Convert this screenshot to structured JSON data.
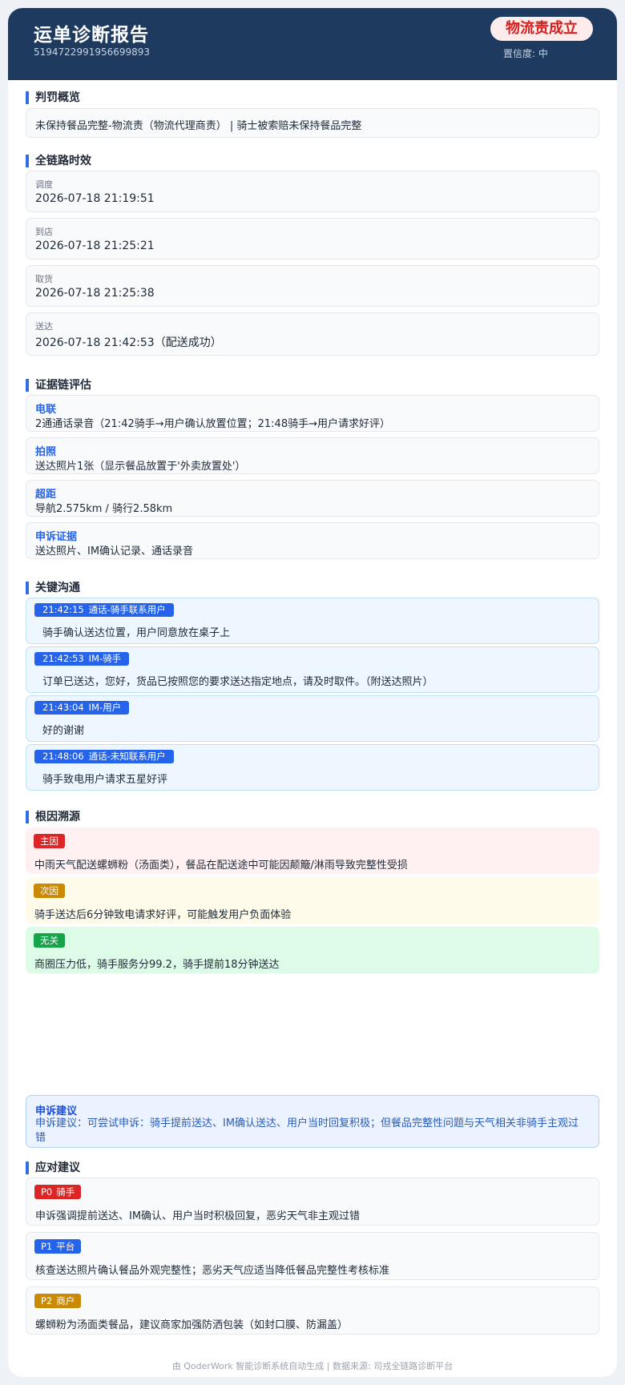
{
  "colors": {
    "header_bg": "#1e3a5f",
    "accent": "#2f6ee5",
    "verdict_red": "#d61f1f",
    "primary_tag": "#dc2626",
    "secondary_tag": "#ca8a04",
    "unrelated_tag": "#16a34a",
    "p1_tag": "#2563eb"
  },
  "header": {
    "title": "运单诊断报告",
    "order_id": "5194722991956699893",
    "verdict": "物流责成立",
    "confidence": "置信度: 中"
  },
  "penalty": {
    "title": "判罚概览",
    "text": "未保持餐品完整-物流责（物流代理商责） | 骑士被索赔未保持餐品完整"
  },
  "timeline": {
    "title": "全链路时效",
    "items": [
      {
        "label": "调度",
        "value": "2026-07-18 21:19:51"
      },
      {
        "label": "到店",
        "value": "2026-07-18 21:25:21"
      },
      {
        "label": "取货",
        "value": "2026-07-18 21:25:38"
      },
      {
        "label": "送达",
        "value": "2026-07-18 21:42:53（配送成功）"
      }
    ]
  },
  "evidence": {
    "title": "证据链评估",
    "items": [
      {
        "key": "电联",
        "value": "2通通话录音（21:42骑手→用户确认放置位置；21:48骑手→用户请求好评）"
      },
      {
        "key": "拍照",
        "value": "送达照片1张（显示餐品放置于'外卖放置处'）"
      },
      {
        "key": "超距",
        "value": "导航2.575km / 骑行2.58km"
      },
      {
        "key": "申诉证据",
        "value": "送达照片、IM确认记录、通话录音"
      }
    ]
  },
  "communication": {
    "title": "关键沟通",
    "items": [
      {
        "time": "21:42:15",
        "type": "通话-骑手联系用户",
        "text": "骑手确认送达位置，用户同意放在桌子上"
      },
      {
        "time": "21:42:53",
        "type": "IM-骑手",
        "text": "订单已送达，您好，货品已按照您的要求送达指定地点，请及时取件。（附送达照片）"
      },
      {
        "time": "21:43:04",
        "type": "IM-用户",
        "text": "好的谢谢"
      },
      {
        "time": "21:48:06",
        "type": "通话-未知联系用户",
        "text": "骑手致电用户请求五星好评"
      }
    ]
  },
  "root_cause": {
    "title": "根因溯源",
    "items": [
      {
        "tag": "主因",
        "text": "中雨天气配送螺蛳粉（汤面类），餐品在配送途中可能因颠簸/淋雨导致完整性受损"
      },
      {
        "tag": "次因",
        "text": "骑手送达后6分钟致电请求好评，可能触发用户负面体验"
      },
      {
        "tag": "无关",
        "text": "商圈压力低，骑手服务分99.2，骑手提前18分钟送达"
      }
    ]
  },
  "appeal": {
    "title": "申诉建议",
    "text": "申诉建议：可尝试申诉：骑手提前送达、IM确认送达、用户当时回复积极；但餐品完整性问题与天气相关非骑手主观过错"
  },
  "actions": {
    "title": "应对建议",
    "items": [
      {
        "level": "P0",
        "role": "骑手",
        "text": "申诉强调提前送达、IM确认、用户当时积极回复，恶劣天气非主观过错"
      },
      {
        "level": "P1",
        "role": "平台",
        "text": "核查送达照片确认餐品外观完整性；恶劣天气应适当降低餐品完整性考核标准"
      },
      {
        "level": "P2",
        "role": "商户",
        "text": "螺蛳粉为汤面类餐品，建议商家加强防洒包装（如封口膜、防漏盖）"
      }
    ]
  },
  "footer": {
    "text": "由 QoderWork 智能诊断系统自动生成 | 数据来源: 司戎全链路诊断平台"
  }
}
